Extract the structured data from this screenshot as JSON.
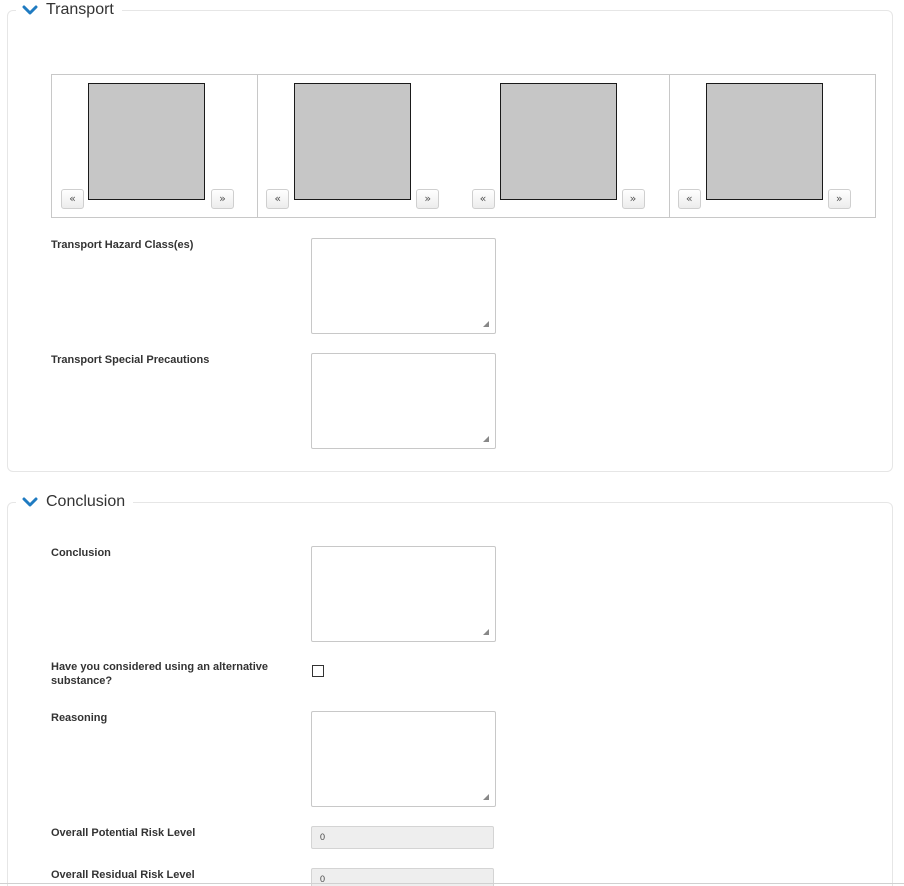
{
  "colors": {
    "accent": "#1f7bc1",
    "label_text": "#333333",
    "thumb_fill": "#c6c6c6"
  },
  "transport": {
    "title": "Transport",
    "carousel": {
      "prev_glyph": "«",
      "next_glyph": "»"
    },
    "hazard_class_label": "Transport Hazard Class(es)",
    "special_precautions_label": "Transport Special Precautions"
  },
  "conclusion": {
    "title": "Conclusion",
    "conclusion_label": "Conclusion",
    "alternative_label": "Have you considered using an alternative substance?",
    "reasoning_label": "Reasoning",
    "potential_risk_label": "Overall Potential Risk Level",
    "potential_risk_value": "0",
    "residual_risk_label": "Overall Residual Risk Level",
    "residual_risk_value": "0"
  }
}
